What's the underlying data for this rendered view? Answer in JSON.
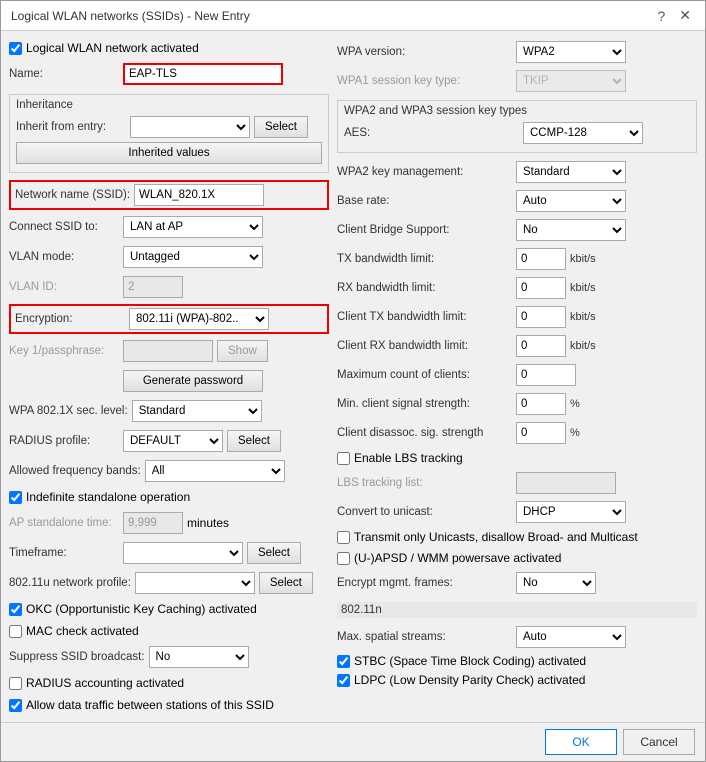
{
  "window": {
    "title": "Logical WLAN networks (SSIDs) - New Entry",
    "help_icon": "?",
    "close_icon": "✕"
  },
  "left": {
    "logical_wlan_activated_label": "Logical WLAN network activated",
    "logical_wlan_activated_checked": true,
    "name_label": "Name:",
    "name_value": "EAP-TLS",
    "inheritance_label": "Inheritance",
    "inherit_from_label": "Inherit from entry:",
    "inherit_from_value": "",
    "select_btn": "Select",
    "inherited_values_btn": "Inherited values",
    "network_name_label": "Network name (SSID):",
    "network_name_value": "WLAN_820.1X",
    "connect_ssid_label": "Connect SSID to:",
    "connect_ssid_value": "LAN at AP",
    "connect_ssid_options": [
      "LAN at AP"
    ],
    "vlan_mode_label": "VLAN mode:",
    "vlan_mode_value": "Untagged",
    "vlan_mode_options": [
      "Untagged"
    ],
    "vlan_id_label": "VLAN ID:",
    "vlan_id_value": "2",
    "encryption_label": "Encryption:",
    "encryption_value": "802.11i (WPA)-802..",
    "encryption_options": [
      "802.11i (WPA)-802.."
    ],
    "key_passphrase_label": "Key 1/passphrase:",
    "key_passphrase_value": "",
    "show_btn": "Show",
    "generate_password_btn": "Generate password",
    "wpa_sec_label": "WPA 802.1X sec. level:",
    "wpa_sec_value": "Standard",
    "wpa_sec_options": [
      "Standard"
    ],
    "radius_profile_label": "RADIUS profile:",
    "radius_profile_value": "DEFAULT",
    "radius_profile_options": [
      "DEFAULT"
    ],
    "radius_select_btn": "Select",
    "allowed_freq_label": "Allowed frequency bands:",
    "allowed_freq_value": "All",
    "allowed_freq_options": [
      "All"
    ],
    "indefinite_label": "Indefinite standalone operation",
    "indefinite_checked": true,
    "ap_standalone_label": "AP standalone time:",
    "ap_standalone_value": "9,999",
    "minutes_label": "minutes",
    "timeframe_label": "Timeframe:",
    "timeframe_value": "",
    "timeframe_select_btn": "Select",
    "network_profile_label": "802.11u network profile:",
    "network_profile_value": "",
    "network_profile_select_btn": "Select",
    "okc_label": "OKC (Opportunistic Key Caching) activated",
    "okc_checked": true,
    "mac_check_label": "MAC check activated",
    "mac_check_checked": false,
    "suppress_ssid_label": "Suppress SSID broadcast:",
    "suppress_ssid_value": "No",
    "suppress_ssid_options": [
      "No"
    ],
    "radius_accounting_label": "RADIUS accounting activated",
    "radius_accounting_checked": false,
    "allow_data_label": "Allow data traffic between stations of this SSID",
    "allow_data_checked": true
  },
  "right": {
    "wpa_version_label": "WPA version:",
    "wpa_version_value": "WPA2",
    "wpa_version_options": [
      "WPA2"
    ],
    "wpa1_session_label": "WPA1 session key type:",
    "wpa1_session_value": "TKIP",
    "wpa1_session_options": [
      "TKIP"
    ],
    "wpa2_wpa3_label": "WPA2 and WPA3 session key types",
    "aes_label": "AES:",
    "aes_value": "CCMP-128",
    "aes_options": [
      "CCMP-128"
    ],
    "wpa2_key_label": "WPA2 key management:",
    "wpa2_key_value": "Standard",
    "wpa2_key_options": [
      "Standard"
    ],
    "base_rate_label": "Base rate:",
    "base_rate_value": "Auto",
    "base_rate_options": [
      "Auto"
    ],
    "client_bridge_label": "Client Bridge Support:",
    "client_bridge_value": "No",
    "client_bridge_options": [
      "No"
    ],
    "tx_bw_label": "TX bandwidth limit:",
    "tx_bw_value": "0",
    "tx_bw_unit": "kbit/s",
    "rx_bw_label": "RX bandwidth limit:",
    "rx_bw_value": "0",
    "rx_bw_unit": "kbit/s",
    "client_tx_label": "Client TX bandwidth limit:",
    "client_tx_value": "0",
    "client_tx_unit": "kbit/s",
    "client_rx_label": "Client RX bandwidth limit:",
    "client_rx_value": "0",
    "client_rx_unit": "kbit/s",
    "max_clients_label": "Maximum count of clients:",
    "max_clients_value": "0",
    "min_signal_label": "Min. client signal strength:",
    "min_signal_value": "0",
    "min_signal_unit": "%",
    "client_disassoc_label": "Client disassoc. sig. strength",
    "client_disassoc_value": "0",
    "client_disassoc_unit": "%",
    "enable_lbs_label": "Enable LBS tracking",
    "enable_lbs_checked": false,
    "lbs_tracking_label": "LBS tracking list:",
    "lbs_tracking_value": "",
    "convert_unicast_label": "Convert to unicast:",
    "convert_unicast_value": "DHCP",
    "convert_unicast_options": [
      "DHCP"
    ],
    "transmit_only_label": "Transmit only Unicasts, disallow Broad- and Multicast",
    "transmit_only_checked": false,
    "uapsd_label": "(U-)APSD / WMM powersave activated",
    "uapsd_checked": false,
    "encrypt_mgmt_label": "Encrypt mgmt. frames:",
    "encrypt_mgmt_value": "No",
    "encrypt_mgmt_options": [
      "No"
    ],
    "dot11n_label": "802.11n",
    "max_spatial_label": "Max. spatial streams:",
    "max_spatial_value": "Auto",
    "max_spatial_options": [
      "Auto"
    ],
    "stbc_label": "STBC (Space Time Block Coding) activated",
    "stbc_checked": true,
    "ldpc_label": "LDPC (Low Density Parity Check) activated",
    "ldpc_checked": true
  },
  "footer": {
    "ok_label": "OK",
    "cancel_label": "Cancel"
  }
}
